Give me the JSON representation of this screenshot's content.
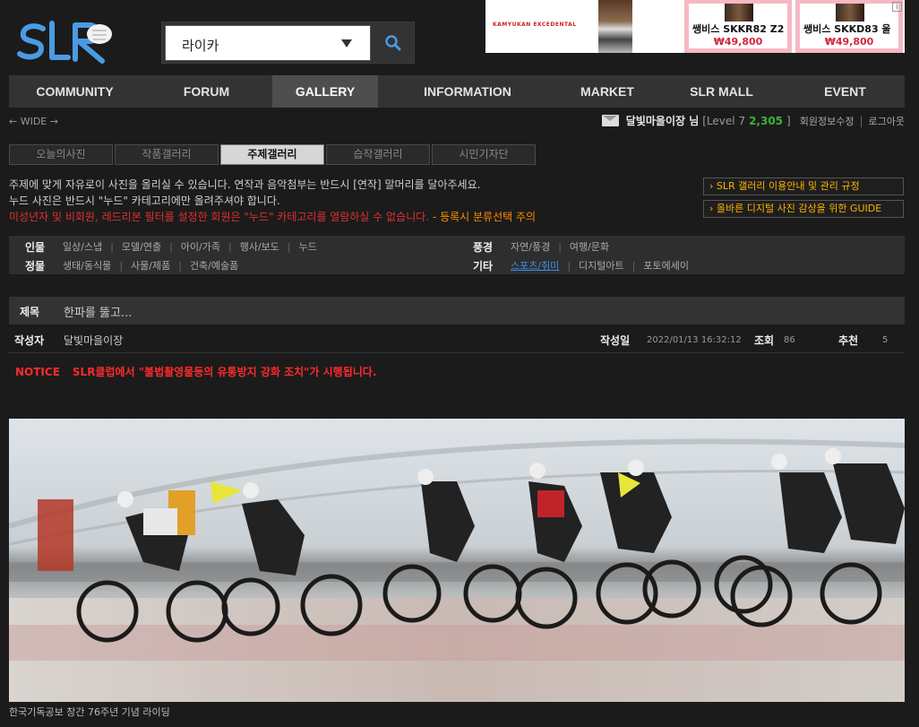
{
  "logo_text": "SLR",
  "search": {
    "category_value": "라이카",
    "icon": "search-icon"
  },
  "ad": {
    "brand_text": "KAMYUKAN EXCEDENTAL",
    "items": [
      {
        "name": "쌩비스 SKKR82 Z2",
        "price": "₩49,800"
      },
      {
        "name": "쌩비스 SKKD83 울",
        "price": "₩49,800"
      }
    ],
    "info_icon": "i"
  },
  "nav": {
    "items": [
      "COMMUNITY",
      "FORUM",
      "GALLERY",
      "INFORMATION",
      "MARKET",
      "SLR MALL",
      "EVENT"
    ],
    "active": "GALLERY"
  },
  "wide_toggle": "← WIDE →",
  "user": {
    "nickname": "달빛마을이장 님",
    "level_open": "[Level 7",
    "points": "2,305",
    "level_close": "]",
    "edit_info": "회원정보수정",
    "logout": "로그아웃"
  },
  "subtabs": {
    "items": [
      "오늘의사진",
      "작품갤러리",
      "주제갤러리",
      "습작갤러리",
      "시민기자단"
    ],
    "active": "주제갤러리"
  },
  "notices": {
    "line1": "주제에 맞게 자유로이 사진을 올리실 수 있습니다. 연작과 음악첨부는 반드시 [연작] 말머리를 달아주세요.",
    "line2": "누드 사진은 반드시 \"누드\" 카테고리에만 올려주셔야 합니다.",
    "line3": "미성년자 및 비회원, 레드리본 필터를 설정한 회원은 \"누드\" 카테고리를 열람하실 수 없습니다.",
    "line3_orange": " - 등록시 분류선택 주의"
  },
  "guide_buttons": [
    "› SLR 갤러리 이용안내 및 관리 규정",
    "› 올바른 디지털 사진 감상을 위한 GUIDE"
  ],
  "categories": {
    "person": {
      "label": "인물",
      "links": [
        "일상/스냅",
        "모델/연출",
        "아이/가족",
        "행사/보도",
        "누드"
      ]
    },
    "scenery": {
      "label": "풍경",
      "links": [
        "자연/풍경",
        "여행/문화"
      ]
    },
    "still": {
      "label": "정물",
      "links": [
        "생태/동식물",
        "사물/제품",
        "건축/예술품"
      ]
    },
    "etc": {
      "label": "기타",
      "links": [
        "스포츠/취미",
        "디지털아트",
        "포토에세이"
      ],
      "selected": "스포츠/취미"
    }
  },
  "post": {
    "title_label": "제목",
    "title": "한파를 뚫고...",
    "author_label": "작성자",
    "author": "달빛마을이장",
    "date_label": "작성일",
    "date": "2022/01/13 16:32:12",
    "views_label": "조회",
    "views": "86",
    "likes_label": "추천",
    "likes": "5"
  },
  "notice_bar": {
    "tag": "NOTICE",
    "text": "SLR클럽에서 \"불법촬영물등의 유통방지 강화 조치\"가 시행됩니다."
  },
  "photo_caption": "한국기독공보 창간 76주년 기념 라이딩",
  "colors": {
    "background": "#1b1b1b",
    "nav_bg": "#333333",
    "accent_blue": "#3d8ef0",
    "notice_red": "#ff2a2a",
    "points_green": "#36b536",
    "guide_orange": "#ffb400"
  }
}
